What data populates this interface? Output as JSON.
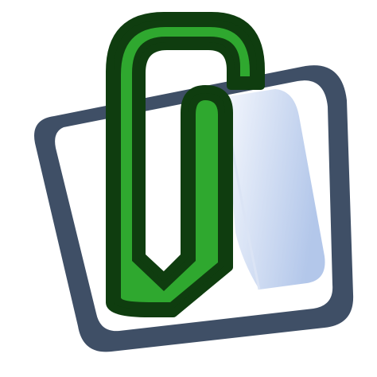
{
  "icon": {
    "name": "attachment-icon",
    "depicts": [
      "paperclip",
      "document"
    ],
    "colors": {
      "clip_fill": "#2fa82f",
      "clip_outline": "#0f3d0f",
      "paper_fill": "#ffffff",
      "paper_outline": "#3f4f66",
      "fold_shade_light": "#f4f7fd",
      "fold_shade_dark": "#b3c7ea"
    }
  }
}
